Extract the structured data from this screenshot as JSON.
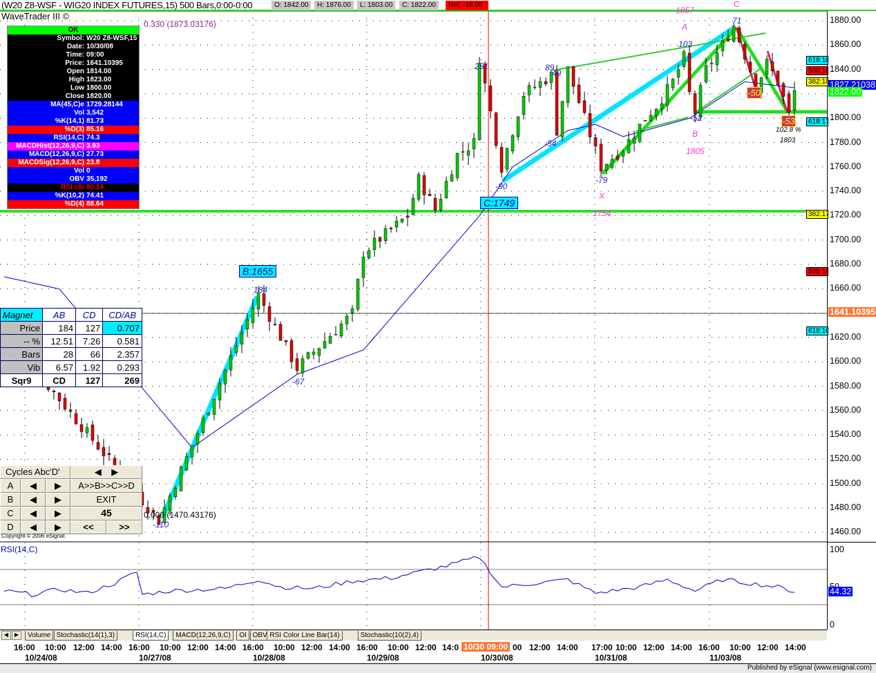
{
  "title": "(W20 Z8-WSF - WIG20 INDEX FUTURES,15) 500 Bars,0:00-0:00",
  "ohlc": {
    "open": "O: 1842.00",
    "high": "H: 1876.00",
    "low": "L: 1803.00",
    "close": "C: 1822.00",
    "net": "Net: -18.00"
  },
  "brand": "WaveTrader III ©",
  "ratio_top": "0.330 (1873.03176)",
  "ratio_bottom": "0.000 (1470.43176)",
  "data_window": {
    "ok": "OK",
    "rows": [
      {
        "k": "Symbol:",
        "v": "W20 Z8-WSF,15",
        "c": "bk"
      },
      {
        "k": "Date:",
        "v": "10/30/08",
        "c": "bk"
      },
      {
        "k": "Time:",
        "v": "09:00",
        "c": "bk"
      },
      {
        "k": "Price:",
        "v": "1641.10395",
        "c": "bk"
      },
      {
        "k": "Open",
        "v": "1814.00",
        "c": "bk"
      },
      {
        "k": "High",
        "v": "1823.00",
        "c": "bk"
      },
      {
        "k": "Low",
        "v": "1800.00",
        "c": "bk"
      },
      {
        "k": "Close",
        "v": "1820.00",
        "c": "bk"
      },
      {
        "k": "MA(45,C)e",
        "v": "1729.28144",
        "c": "bl"
      },
      {
        "k": "Vol",
        "v": "3,542",
        "c": "bl"
      },
      {
        "k": "%K(14,1)",
        "v": "81.73",
        "c": "bl"
      },
      {
        "k": "%D(3)",
        "v": "85.16",
        "c": "rd"
      },
      {
        "k": "RSI(14,C)",
        "v": "74.3",
        "c": "bl"
      },
      {
        "k": "MACDHist(12,26,9,C)",
        "v": "3.93",
        "c": "mg"
      },
      {
        "k": "MACD(12,26,9,C)",
        "v": "27.73",
        "c": "bl"
      },
      {
        "k": "MACDSig(12,26,9,C)",
        "v": "23.8",
        "c": "rd"
      },
      {
        "k": "Vol",
        "v": "0",
        "c": "bl"
      },
      {
        "k": "OBV",
        "v": "35,192",
        "c": "bl"
      },
      {
        "k": "RSI clb",
        "v": "80.14",
        "c": "bk"
      },
      {
        "k": "%K(10,2)",
        "v": "74.41",
        "c": "bl"
      },
      {
        "k": "%D(4)",
        "v": "88.64",
        "c": "rd"
      }
    ]
  },
  "magnet": {
    "headers": [
      "Magnet",
      "AB",
      "CD",
      "CD/AB"
    ],
    "rows": [
      [
        "Price",
        "184",
        "127",
        "0.707"
      ],
      [
        "-- %",
        "12.51",
        "7.26",
        "0.581"
      ],
      [
        "Bars",
        "28",
        "66",
        "2.357"
      ],
      [
        "Vib",
        "6.57",
        "1.92",
        "0.293"
      ],
      [
        "Sqr9",
        "CD",
        "127",
        "269"
      ]
    ]
  },
  "cycles": {
    "title": "Cycles Abc'D'",
    "rows": [
      "A",
      "B",
      "C",
      "D"
    ],
    "left": "◀",
    "right": "▶",
    "seq": "A>>B>>C>>D",
    "exit": "EXIT",
    "value": "45",
    "prev": "<<",
    "next": ">>"
  },
  "copyright": "Copyright © 2006 eSignal.",
  "price_axis": [
    "1880.00",
    "1860.00",
    "1840.00",
    "1820.00",
    "1800.00",
    "1780.00",
    "1760.00",
    "1740.00",
    "1720.00",
    "1700.00",
    "1680.00",
    "1660.00",
    "1640.00",
    "1620.00",
    "1600.00",
    "1580.00",
    "1560.00",
    "1540.00",
    "1520.00",
    "1500.00",
    "1480.00",
    "1460.00"
  ],
  "axis_tags": {
    "last": "1827.21038",
    "close": "1822.00",
    "cursor": "1641.10395",
    "fib": [
      "618:18",
      "500:18",
      "382:18",
      "618:17",
      "382:17",
      "500:16",
      "618:16"
    ]
  },
  "rsi": {
    "label": "RSI(14,C)",
    "axis": [
      "100",
      "50",
      "0"
    ],
    "value": "44.32"
  },
  "annotations": {
    "c": "C",
    "a": "A",
    "b": "B",
    "x": "X",
    "p1857": "1857",
    "p1805": "1805",
    "p1754": "1754",
    "n71": "71",
    "n103": "103",
    "n89": "89",
    "n49": "49",
    "n251": "251",
    "n54": "-54",
    "n52": "-52",
    "n79": "-79",
    "n90": "-90",
    "n50": "-50",
    "n53": "-53",
    "pct": "102.8 %",
    "p1803": "1803",
    "n184": "184",
    "n67": "-67",
    "n110": "-110",
    "b1655": "B:1655",
    "c1749": "C:1749"
  },
  "tabs": [
    "Volume",
    "Stochastic(14(1),3)",
    "RSI(14,C)",
    "MACD(12,26,9,C)",
    "OI",
    "OBV",
    "RSI Color Line Bar(14)",
    "Stochastic(10(2),4)"
  ],
  "time_axis": {
    "times": [
      "16:00",
      "10:00",
      "12:00",
      "14:00",
      "16:00",
      "10:00",
      "12:00",
      "14:00",
      "16:00",
      "10:00",
      "12:00",
      "14:00",
      "16:00",
      "10:00",
      "12:00",
      "14:0",
      "00",
      "12:00",
      "14:00",
      "17:00",
      "10:00",
      "12:00",
      "14:00",
      "16:00",
      "10:00",
      "12:00",
      "14:00"
    ],
    "dates": [
      "10/24/08",
      "10/27/08",
      "10/28/08",
      "10/29/08",
      "10/30/08",
      "10/31/08",
      "11/03/08"
    ],
    "cursor": "10/30 09:00"
  },
  "status": "Published by eSignal (www.esignal.com)",
  "colors": {
    "up": "#00cc00",
    "down": "#e00000",
    "ma": "#0000cc",
    "cyan": "#00e5ff",
    "green": "#33dd33",
    "magenta": "#ff33cc"
  },
  "chart_data": {
    "type": "candlestick",
    "ylim": [
      1460,
      1880
    ],
    "price_waypoints": [
      [
        0,
        1625
      ],
      [
        28,
        1470
      ],
      [
        46,
        1655
      ],
      [
        53,
        1595
      ],
      [
        63,
        1640
      ],
      [
        65,
        1690
      ],
      [
        73,
        1720
      ],
      [
        75,
        1750
      ],
      [
        78,
        1725
      ],
      [
        82,
        1770
      ],
      [
        85,
        1780
      ],
      [
        86,
        1850
      ],
      [
        90,
        1760
      ],
      [
        94,
        1820
      ],
      [
        99,
        1835
      ],
      [
        100,
        1790
      ],
      [
        102,
        1840
      ],
      [
        105,
        1800
      ],
      [
        108,
        1760
      ],
      [
        112,
        1775
      ],
      [
        116,
        1800
      ],
      [
        118,
        1810
      ],
      [
        121,
        1830
      ],
      [
        123,
        1850
      ],
      [
        124,
        1820
      ],
      [
        125,
        1805
      ],
      [
        127,
        1840
      ],
      [
        130,
        1860
      ],
      [
        132,
        1876
      ],
      [
        135,
        1840
      ],
      [
        136,
        1825
      ],
      [
        138,
        1845
      ],
      [
        140,
        1830
      ],
      [
        142,
        1803
      ],
      [
        143,
        1822
      ]
    ],
    "ma_waypoints": [
      [
        0,
        1670
      ],
      [
        10,
        1660
      ],
      [
        34,
        1530
      ],
      [
        53,
        1590
      ],
      [
        65,
        1610
      ],
      [
        86,
        1720
      ],
      [
        92,
        1760
      ],
      [
        102,
        1790
      ],
      [
        107,
        1795
      ],
      [
        112,
        1785
      ],
      [
        124,
        1800
      ],
      [
        134,
        1830
      ],
      [
        143,
        1825
      ]
    ],
    "rsi_waypoints": [
      [
        0,
        45
      ],
      [
        5,
        40
      ],
      [
        10,
        47
      ],
      [
        15,
        42
      ],
      [
        20,
        55
      ],
      [
        24,
        70
      ],
      [
        25,
        40
      ],
      [
        30,
        45
      ],
      [
        40,
        48
      ],
      [
        46,
        60
      ],
      [
        50,
        50
      ],
      [
        56,
        48
      ],
      [
        63,
        58
      ],
      [
        70,
        62
      ],
      [
        80,
        78
      ],
      [
        86,
        90
      ],
      [
        90,
        50
      ],
      [
        96,
        55
      ],
      [
        102,
        60
      ],
      [
        107,
        42
      ],
      [
        115,
        50
      ],
      [
        120,
        60
      ],
      [
        125,
        45
      ],
      [
        130,
        60
      ],
      [
        135,
        55
      ],
      [
        140,
        50
      ],
      [
        143,
        44
      ]
    ]
  }
}
